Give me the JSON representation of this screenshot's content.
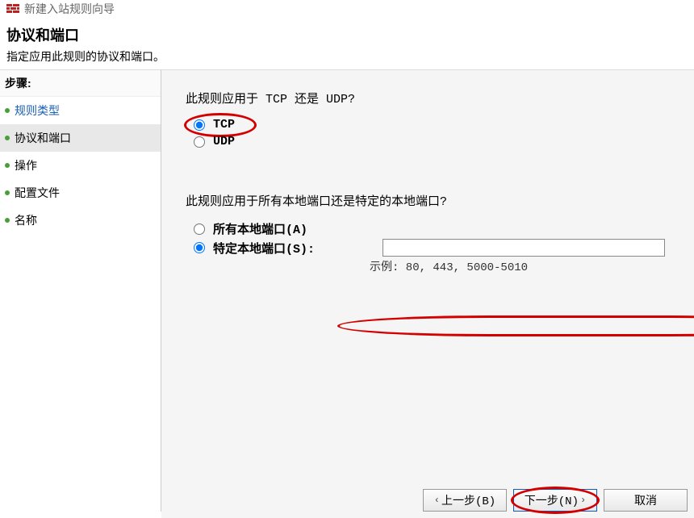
{
  "window": {
    "title": "新建入站规则向导"
  },
  "header": {
    "title": "协议和端口",
    "subtitle": "指定应用此规则的协议和端口。"
  },
  "sidebar": {
    "header": "步骤:",
    "items": [
      {
        "label": "规则类型",
        "state": "completed"
      },
      {
        "label": "协议和端口",
        "state": "current"
      },
      {
        "label": "操作",
        "state": "pending"
      },
      {
        "label": "配置文件",
        "state": "pending"
      },
      {
        "label": "名称",
        "state": "pending"
      }
    ]
  },
  "main": {
    "protocol_question": "此规则应用于 TCP 还是 UDP?",
    "protocol_options": {
      "tcp": "TCP",
      "udp": "UDP",
      "selected": "tcp"
    },
    "port_question": "此规则应用于所有本地端口还是特定的本地端口?",
    "port_options": {
      "all": "所有本地端口(A)",
      "specific": "特定本地端口(S):",
      "selected": "specific"
    },
    "port_input_value": "",
    "port_example": "示例: 80, 443, 5000-5010"
  },
  "footer": {
    "back": "上一步(B)",
    "next": "下一步(N)",
    "cancel": "取消"
  }
}
